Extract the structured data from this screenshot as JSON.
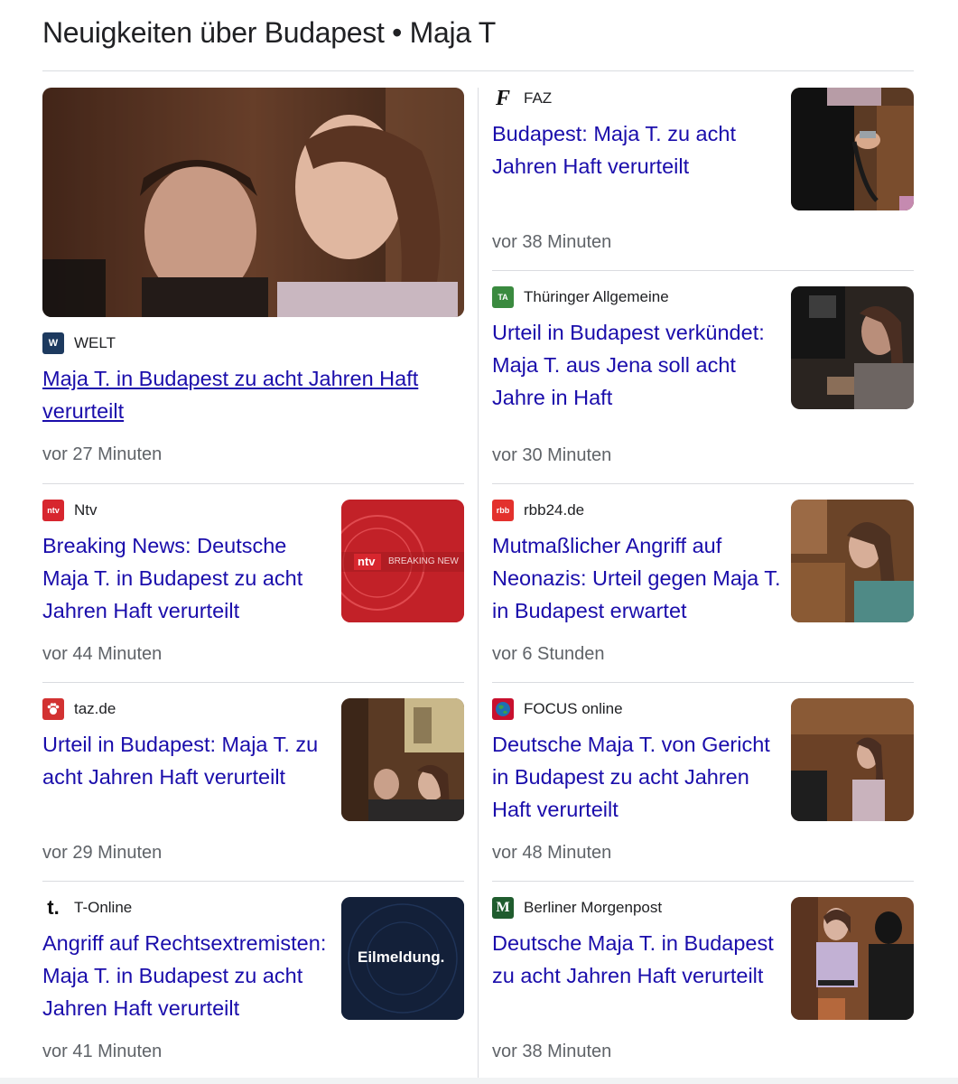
{
  "heading": "Neuigkeiten über Budapest • Maja T",
  "colors": {
    "link": "#1a0dab",
    "meta": "#5f6368",
    "divider": "#dadce0"
  },
  "articles": [
    {
      "source": "WELT",
      "logo_text": "W",
      "logo_color": "#1d3a5f",
      "title": "Maja T. in Budapest zu acht Jahren Haft verurteilt",
      "time": "vor 27 Minuten",
      "image": "courtroom-defendants-photo"
    },
    {
      "source": "FAZ",
      "logo_text": "F",
      "logo_color": "#ffffff",
      "title": "Budapest: Maja T. zu acht Jahren Haft verurteilt",
      "time": "vor 38 Minuten",
      "image": "handcuffs-photo"
    },
    {
      "source": "Thüringer Allgemeine",
      "logo_text": "TA",
      "logo_color": "#3a8a3f",
      "title": "Urteil in Budapest verkündet: Maja T. aus Jena soll acht Jahre in Haft",
      "time": "vor 30 Minuten",
      "image": "press-cameras-photo"
    },
    {
      "source": "Ntv",
      "logo_text": "ntv",
      "logo_color": "#d7262e",
      "title": "Breaking News: Deutsche Maja T. in Budapest zu acht Jahren Haft verurteilt",
      "time": "vor 44 Minuten",
      "image": "ntv-breaking-news-graphic",
      "image_text": "BREAKING NEW",
      "image_brand": "ntv"
    },
    {
      "source": "rbb24.de",
      "logo_text": "rbb",
      "logo_color": "#e3312d",
      "title": "Mutmaßlicher Angriff auf Neonazis: Urteil gegen Maja T. in Budapest erwartet",
      "time": "vor 6 Stunden",
      "image": "courtroom-profile-photo"
    },
    {
      "source": "taz.de",
      "logo_text": "",
      "logo_color": "#d23232",
      "title": "Urteil in Budapest: Maja T. zu acht Jahren Haft verurteilt",
      "time": "vor 29 Minuten",
      "image": "courtroom-hall-photo"
    },
    {
      "source": "FOCUS online",
      "logo_text": "",
      "logo_color": "#c8102e",
      "title": "Deutsche Maja T. von Gericht in Budapest zu acht Jahren Haft verurteilt",
      "time": "vor 48 Minuten",
      "image": "courtroom-standing-photo"
    },
    {
      "source": "T-Online",
      "logo_text": "t.",
      "logo_color": "#ffffff",
      "title": "Angriff auf Rechtsextremisten: Maja T. in Budapest zu acht Jahren Haft verurteilt",
      "time": "vor 41 Minuten",
      "image": "eilmeldung-graphic",
      "image_text": "Eilmeldung."
    },
    {
      "source": "Berliner Morgenpost",
      "logo_text": "M",
      "logo_color": "#1f5c2e",
      "title": "Deutsche Maja T. in Budapest zu acht Jahren Haft verurteilt",
      "time": "vor 38 Minuten",
      "image": "escorted-defendant-photo"
    }
  ]
}
